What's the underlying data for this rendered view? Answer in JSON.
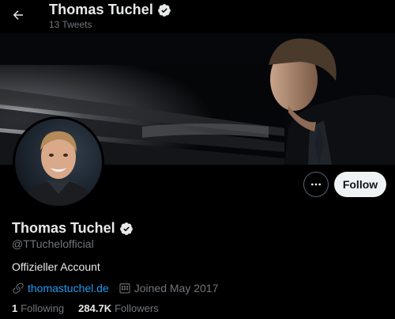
{
  "header": {
    "name": "Thomas Tuchel",
    "tweet_count": "13 Tweets"
  },
  "profile": {
    "display_name": "Thomas Tuchel",
    "handle": "@TTuchelofficial",
    "bio": "Offizieller Account",
    "website": "thomastuchel.de",
    "joined": "Joined May 2017",
    "following_count": "1",
    "following_label": "Following",
    "followers_count": "284.7K",
    "followers_label": "Followers"
  },
  "actions": {
    "follow_label": "Follow"
  },
  "icons": {
    "back": "arrow-left-icon",
    "verified": "verified-badge-icon",
    "more": "more-horizontal-icon",
    "link": "link-icon",
    "calendar": "calendar-icon"
  },
  "colors": {
    "background": "#000000",
    "link": "#1d9bf0",
    "muted": "#71767b",
    "text": "#e7e9ea",
    "follow_bg": "#eff3f4"
  }
}
